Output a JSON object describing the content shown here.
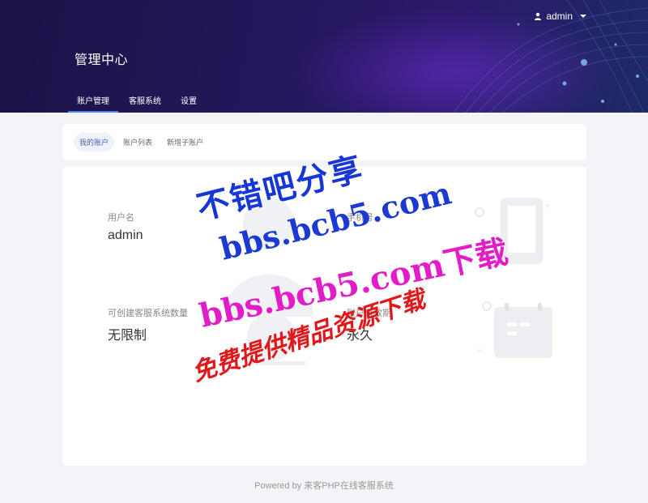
{
  "header": {
    "user_name": "admin",
    "title": "管理中心",
    "nav": [
      "账户管理",
      "客服系统",
      "设置"
    ]
  },
  "subtabs": [
    "我的账户",
    "账户列表",
    "新增子账户"
  ],
  "account": {
    "fields": [
      {
        "label": "用户名",
        "value": "admin"
      },
      {
        "label": "手机号",
        "value": ""
      },
      {
        "label": "可创建客服系统数量",
        "value": "无限制"
      },
      {
        "label": "账户有效期",
        "value": "永久"
      }
    ]
  },
  "footer": "Powered by 来客PHP在线客服系统",
  "watermark": {
    "line1": "不错吧分享",
    "line2": "bbs.bcb5.com",
    "line3": "bbs.bcb5.com下载",
    "line4": "免费提供精品资源下载"
  },
  "colors": {
    "header_bg": "#24175c",
    "accent": "#4f7cff",
    "page_bg": "#f3f4f7"
  }
}
